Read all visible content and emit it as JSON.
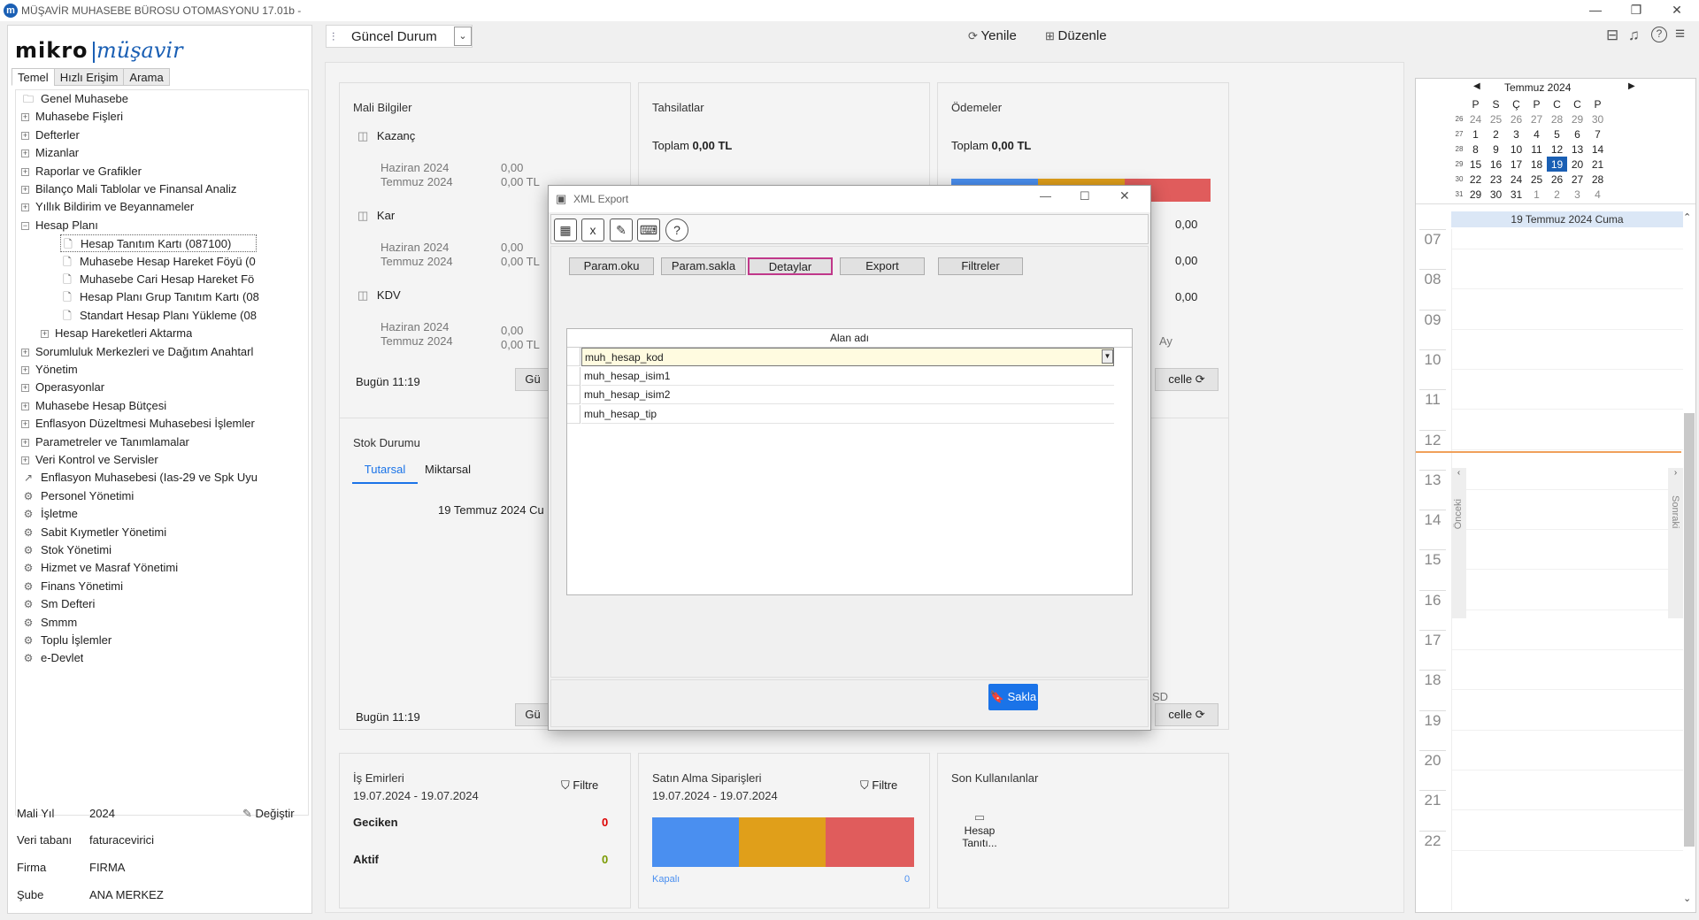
{
  "window": {
    "title": "MÜŞAVİR MUHASEBE BÜROSU OTOMASYONU 17.01b -",
    "controls": [
      "—",
      "❐",
      "✕"
    ]
  },
  "brand": {
    "part1": "mikro",
    "part2": "müşavir"
  },
  "sidebar": {
    "tabs": [
      "Temel",
      "Hızlı Erişim",
      "Arama"
    ],
    "tree": [
      {
        "label": "Genel Muhasebe",
        "type": "folder"
      },
      {
        "label": "Muhasebe Fişleri",
        "type": "plus"
      },
      {
        "label": "Defterler",
        "type": "plus"
      },
      {
        "label": "Mizanlar",
        "type": "plus"
      },
      {
        "label": "Raporlar ve Grafikler",
        "type": "plus"
      },
      {
        "label": "Bilanço Mali Tablolar ve Finansal Analiz",
        "type": "plus"
      },
      {
        "label": "Yıllık Bildirim ve Beyannameler",
        "type": "plus"
      },
      {
        "label": "Hesap Planı",
        "type": "minus"
      },
      {
        "label": "Hesap Tanıtım Kartı (087100)",
        "type": "doc"
      },
      {
        "label": "Muhasebe Hesap Hareket Föyü (0",
        "type": "doc"
      },
      {
        "label": "Muhasebe Cari Hesap Hareket Fö",
        "type": "doc"
      },
      {
        "label": "Hesap Planı Grup Tanıtım Kartı (08",
        "type": "doc"
      },
      {
        "label": "Standart Hesap Planı Yükleme (08",
        "type": "doc"
      },
      {
        "label": "Hesap Hareketleri Aktarma",
        "type": "plus"
      },
      {
        "label": "Sorumluluk Merkezleri ve Dağıtım Anahtarl",
        "type": "plus"
      },
      {
        "label": "Yönetim",
        "type": "plus"
      },
      {
        "label": "Operasyonlar",
        "type": "plus"
      },
      {
        "label": "Muhasebe Hesap Bütçesi",
        "type": "plus"
      },
      {
        "label": "Enflasyon Düzeltmesi Muhasebesi İşlemler",
        "type": "plus"
      },
      {
        "label": "Parametreler ve Tanımlamalar",
        "type": "plus"
      },
      {
        "label": "Veri Kontrol ve Servisler",
        "type": "plus"
      },
      {
        "label": "Enflasyon Muhasebesi (Ias-29 ve Spk Uyu",
        "type": "chart"
      },
      {
        "label": "Personel Yönetimi",
        "type": "module"
      },
      {
        "label": "İşletme",
        "type": "module"
      },
      {
        "label": "Sabit Kıymetler Yönetimi",
        "type": "module"
      },
      {
        "label": "Stok Yönetimi",
        "type": "module"
      },
      {
        "label": "Hizmet ve Masraf Yönetimi",
        "type": "module"
      },
      {
        "label": "Finans Yönetimi",
        "type": "module"
      },
      {
        "label": "Sm Defteri",
        "type": "module"
      },
      {
        "label": "Smmm",
        "type": "module"
      },
      {
        "label": "Toplu İşlemler",
        "type": "module"
      },
      {
        "label": "e-Devlet",
        "type": "module"
      }
    ],
    "info": {
      "mali_yil_label": "Mali Yıl",
      "mali_yil": "2024",
      "degistir": "Değiştir",
      "veri_tabani_label": "Veri tabanı",
      "veri_tabani": "faturacevirici",
      "firma_label": "Firma",
      "firma": "FIRMA",
      "sube_label": "Şube",
      "sube": "ANA MERKEZ"
    }
  },
  "topbar": {
    "view": "Güncel Durum",
    "refresh": "Yenile",
    "edit": "Düzenle"
  },
  "dashboard": {
    "mali": {
      "title": "Mali Bilgiler",
      "groups": [
        {
          "name": "Kazanç",
          "rows": [
            [
              "Haziran 2024",
              "0,00"
            ],
            [
              "Temmuz 2024",
              "0,00 TL"
            ]
          ]
        },
        {
          "name": "Kar",
          "rows": [
            [
              "Haziran 2024",
              "0,00"
            ],
            [
              "Temmuz 2024",
              "0,00 TL"
            ]
          ]
        },
        {
          "name": "KDV",
          "rows": [
            [
              "Haziran 2024",
              "0,00"
            ],
            [
              "Temmuz 2024",
              "0,00 TL"
            ]
          ]
        }
      ],
      "today": "Bugün 11:19",
      "btn": "Gü"
    },
    "tahsilat": {
      "title": "Tahsilatlar",
      "total_label": "Toplam",
      "total": "0,00 TL"
    },
    "odeme": {
      "title": "Ödemeler",
      "total_label": "Toplam",
      "total": "0,00 TL",
      "values": [
        "0,00",
        "0,00",
        "0,00"
      ],
      "ay": "Ay",
      "btn": "celle"
    },
    "stok": {
      "title": "Stok Durumu",
      "tabs": [
        "Tutarsal",
        "Miktarsal"
      ],
      "date": "19 Temmuz 2024 Cu",
      "today": "Bugün 11:19",
      "btn": "Gü",
      "usd": "SD",
      "btn2": "celle"
    },
    "is_emirleri": {
      "title": "İş Emirleri",
      "filter": "Filtre",
      "range": "19.07.2024 - 19.07.2024",
      "rows": [
        {
          "label": "Geciken",
          "value": "0"
        },
        {
          "label": "Aktif",
          "value": "0"
        }
      ]
    },
    "satin_alma": {
      "title": "Satın Alma Siparişleri",
      "filter": "Filtre",
      "range": "19.07.2024 - 19.07.2024",
      "bar_colors": [
        "#4a8ff0",
        "#e09f1a",
        "#e05c5c"
      ],
      "footer": "Kapalı",
      "footer_val": "0"
    },
    "son": {
      "title": "Son Kullanılanlar",
      "item": "Hesap Tanıtı..."
    }
  },
  "calendar": {
    "month": "Temmuz 2024",
    "days": [
      "P",
      "S",
      "Ç",
      "P",
      "C",
      "C",
      "P"
    ],
    "weeks": [
      {
        "wk": "26",
        "d": [
          "24",
          "25",
          "26",
          "27",
          "28",
          "29",
          "30"
        ]
      },
      {
        "wk": "27",
        "d": [
          "1",
          "2",
          "3",
          "4",
          "5",
          "6",
          "7"
        ]
      },
      {
        "wk": "28",
        "d": [
          "8",
          "9",
          "10",
          "11",
          "12",
          "13",
          "14"
        ]
      },
      {
        "wk": "29",
        "d": [
          "15",
          "16",
          "17",
          "18",
          "19",
          "20",
          "21"
        ]
      },
      {
        "wk": "30",
        "d": [
          "22",
          "23",
          "24",
          "25",
          "26",
          "27",
          "28"
        ]
      },
      {
        "wk": "31",
        "d": [
          "29",
          "30",
          "31",
          "1",
          "2",
          "3",
          "4"
        ]
      }
    ],
    "selected": "19",
    "day_header": "19 Temmuz 2024 Cuma",
    "hours": [
      "07",
      "08",
      "09",
      "10",
      "11",
      "12",
      "13",
      "14",
      "15",
      "16",
      "17",
      "18",
      "19",
      "20",
      "21",
      "22"
    ],
    "prev": "Önceki",
    "next": "Sonraki"
  },
  "dialog": {
    "title": "XML Export",
    "buttons": [
      "Param.oku",
      "Param.sakla",
      "Detaylar",
      "Export",
      "Filtreler"
    ],
    "grid_header": "Alan adı",
    "rows": [
      "muh_hesap_kod",
      "muh_hesap_isim1",
      "muh_hesap_isim2",
      "muh_hesap_tip"
    ],
    "save": "Sakla"
  }
}
